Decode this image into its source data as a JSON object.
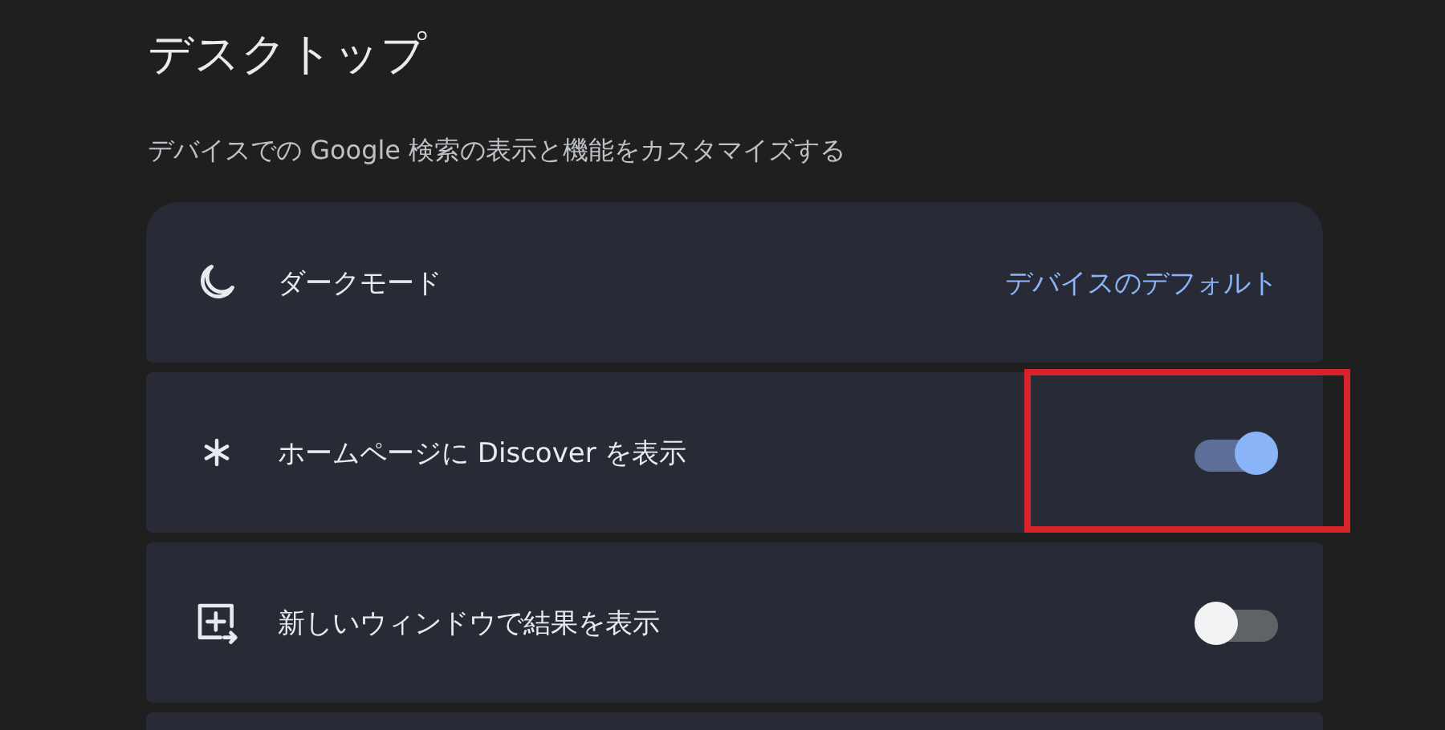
{
  "title": "デスクトップ",
  "subtitle": "デバイスでの Google 検索の表示と機能をカスタマイズする",
  "rows": [
    {
      "kind": "link",
      "label": "ダークモード",
      "value": "デバイスのデフォルト",
      "highlighted": false
    },
    {
      "kind": "toggle",
      "label": "ホームページに Discover を表示",
      "on": true,
      "highlighted": true
    },
    {
      "kind": "toggle",
      "label": "新しいウィンドウで結果を表示",
      "on": false,
      "highlighted": false
    }
  ]
}
